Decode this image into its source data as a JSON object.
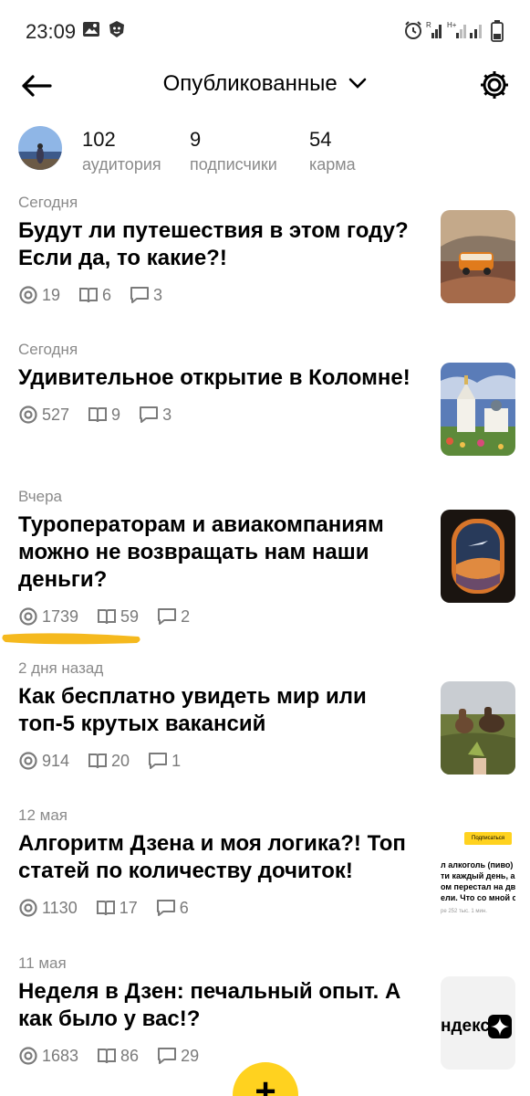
{
  "status_bar": {
    "time": "23:09",
    "icons": [
      "gallery-icon",
      "lion-app-icon",
      "alarm-icon",
      "signal-r-icon",
      "signal-h-plus-icon",
      "signal-icon",
      "battery-icon"
    ]
  },
  "header": {
    "title": "Опубликованные",
    "back_icon": "arrow-left-icon",
    "dropdown_icon": "chevron-down-icon",
    "settings_icon": "gear-icon"
  },
  "profile": {
    "stats": [
      {
        "value": "102",
        "label": "аудитория"
      },
      {
        "value": "9",
        "label": "подписчики"
      },
      {
        "value": "54",
        "label": "карма"
      }
    ]
  },
  "posts": [
    {
      "date": "Сегодня",
      "title": "Будут ли путешествия в этом году? Если да, то какие?!",
      "views": "19",
      "reads": "6",
      "comments": "3",
      "thumb": "van-on-road"
    },
    {
      "date": "Сегодня",
      "title": "Удивительное открытие в Коломне!",
      "views": "527",
      "reads": "9",
      "comments": "3",
      "thumb": "church-kolomna"
    },
    {
      "date": "Вчера",
      "title": "Туроператорам и авиакомпаниям можно не возвращать нам наши деньги?",
      "views": "1739",
      "reads": "59",
      "comments": "2",
      "thumb": "airplane-window"
    },
    {
      "date": "2 дня назад",
      "title": "Как бесплатно увидеть мир или топ-5 крутых вакансий",
      "views": "914",
      "reads": "20",
      "comments": "1",
      "thumb": "horses-field"
    },
    {
      "date": "12 мая",
      "title": "Алгоритм Дзена и моя логика?! Топ статей по количеству дочиток!",
      "views": "1130",
      "reads": "17",
      "comments": "6",
      "thumb": "article-screenshot"
    },
    {
      "date": "11 мая",
      "title": "Неделя в Дзен: печальный опыт. А как было у вас!?",
      "views": "1683",
      "reads": "86",
      "comments": "29",
      "thumb": "yandex-zen-logo"
    }
  ],
  "thumb_texts": {
    "p5_badge": "Подписаться",
    "p5_lines": [
      "л алкоголь (пиво)",
      "ти каждый день, а",
      "ом перестал на две",
      "ели. Что со мной ст"
    ],
    "p5_meta": "ре   252 тыс.   1 мин.",
    "p6_text": "ндекс"
  },
  "fab": {
    "label": "+"
  },
  "colors": {
    "accent_yellow": "#ffd21f",
    "muted": "#8a8a8a"
  }
}
